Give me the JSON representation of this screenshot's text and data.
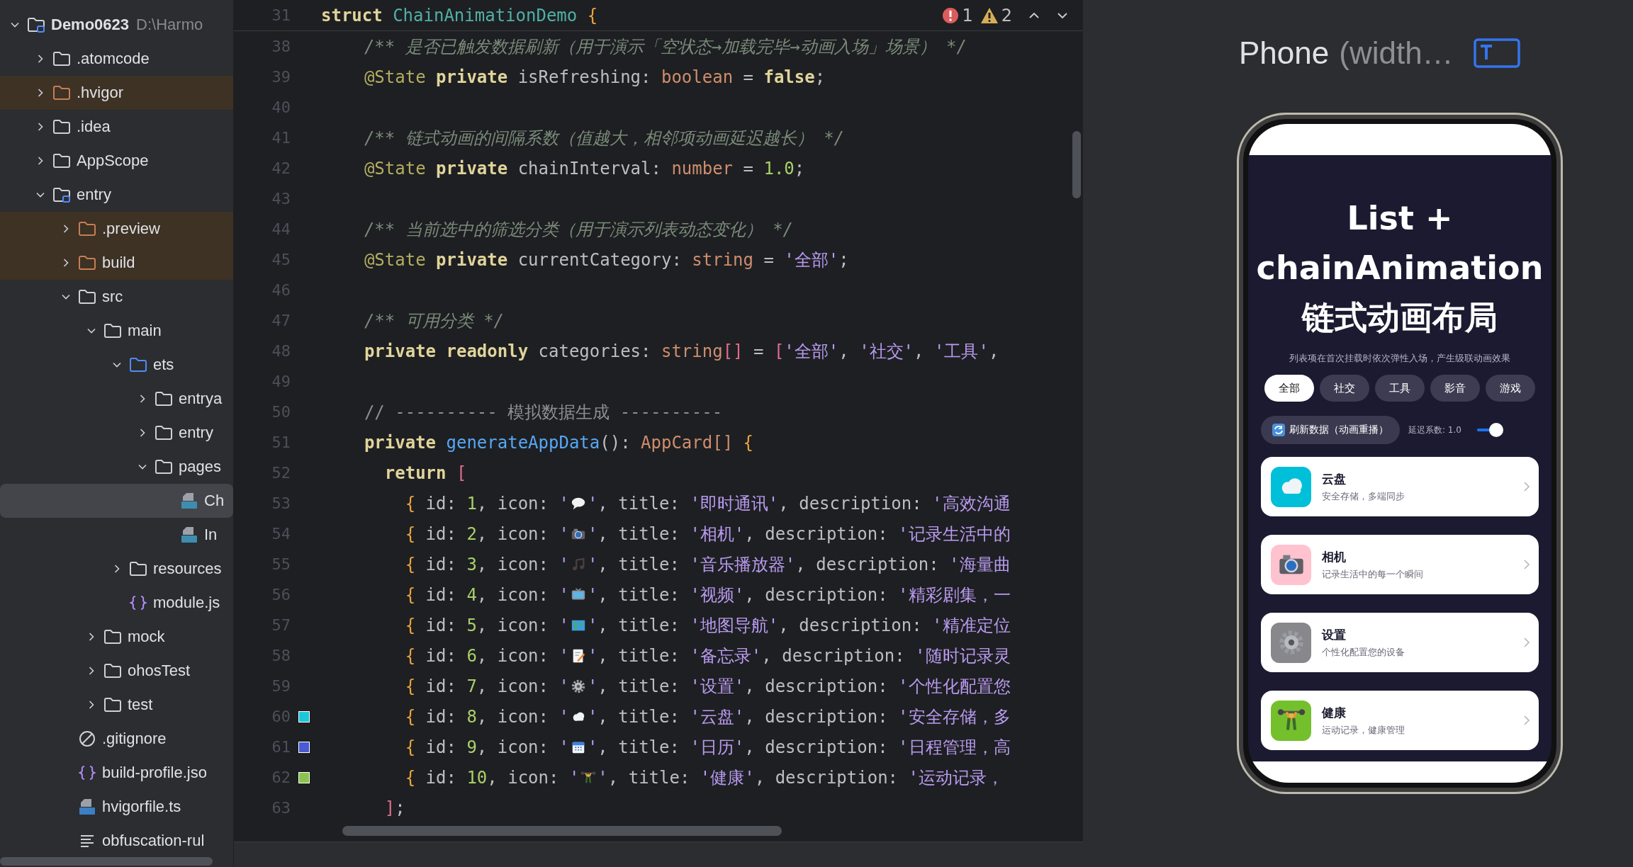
{
  "project_tree": {
    "name": "Demo0623",
    "path": "D:\\Harmo",
    "expanded": true,
    "children": [
      {
        "label": ".atomcode",
        "kind": "folder",
        "expanded": false,
        "excluded": false
      },
      {
        "label": ".hvigor",
        "kind": "folder",
        "expanded": false,
        "excluded": true
      },
      {
        "label": ".idea",
        "kind": "folder",
        "expanded": false,
        "excluded": false
      },
      {
        "label": "AppScope",
        "kind": "folder",
        "expanded": false,
        "excluded": false
      },
      {
        "label": "entry",
        "kind": "module",
        "expanded": true,
        "excluded": false,
        "children": [
          {
            "label": ".preview",
            "kind": "folder",
            "expanded": false,
            "excluded": true
          },
          {
            "label": "build",
            "kind": "folder",
            "expanded": false,
            "excluded": true
          },
          {
            "label": "src",
            "kind": "folder",
            "expanded": true,
            "excluded": false,
            "children": [
              {
                "label": "main",
                "kind": "folder",
                "expanded": true,
                "excluded": false,
                "children": [
                  {
                    "label": "ets",
                    "kind": "source",
                    "expanded": true,
                    "excluded": false,
                    "children": [
                      {
                        "label": "entrya",
                        "kind": "folder",
                        "expanded": false,
                        "excluded": false
                      },
                      {
                        "label": "entry",
                        "kind": "folder",
                        "expanded": false,
                        "excluded": false
                      },
                      {
                        "label": "pages",
                        "kind": "folder",
                        "expanded": true,
                        "excluded": false,
                        "children": [
                          {
                            "label": "Ch",
                            "kind": "ets",
                            "selected": true
                          },
                          {
                            "label": "In",
                            "kind": "ets",
                            "selected": false
                          }
                        ]
                      }
                    ]
                  },
                  {
                    "label": "resources",
                    "kind": "folder",
                    "expanded": false,
                    "excluded": false
                  },
                  {
                    "label": "module.js",
                    "kind": "json",
                    "selected": false
                  }
                ]
              },
              {
                "label": "mock",
                "kind": "folder",
                "expanded": false,
                "excluded": false
              },
              {
                "label": "ohosTest",
                "kind": "folder",
                "expanded": false,
                "excluded": false
              },
              {
                "label": "test",
                "kind": "folder",
                "expanded": false,
                "excluded": false
              }
            ]
          },
          {
            "label": ".gitignore",
            "kind": "ignore",
            "selected": false
          },
          {
            "label": "build-profile.jso",
            "kind": "json",
            "selected": false
          },
          {
            "label": "hvigorfile.ts",
            "kind": "ts",
            "selected": false
          },
          {
            "label": "obfuscation-rul",
            "kind": "text",
            "selected": false
          }
        ]
      }
    ]
  },
  "editor": {
    "sticky_line": {
      "number": "31",
      "segments": [
        {
          "kind": "kw",
          "text": "struct"
        },
        {
          "kind": "cls",
          "text": " ChainAnimationDemo"
        },
        {
          "kind": "brace",
          "text": " {"
        }
      ]
    },
    "inspections": {
      "errors": "1",
      "warnings": "2"
    },
    "lines": [
      {
        "number": "38",
        "segments": [
          {
            "kind": "cmt",
            "text": "  /** 是否已触发数据刷新（用于演示「空状态→加载完毕→动画入场」场景） */"
          }
        ]
      },
      {
        "number": "39",
        "segments": [
          {
            "kind": "ann",
            "text": "  @State"
          },
          {
            "kind": "kw",
            "text": " private"
          },
          {
            "kind": "plain",
            "text": " isRefreshing: "
          },
          {
            "kind": "type",
            "text": "boolean"
          },
          {
            "kind": "plain",
            "text": " = "
          },
          {
            "kind": "kw",
            "text": "false"
          },
          {
            "kind": "plain",
            "text": ";"
          }
        ]
      },
      {
        "number": "40"
      },
      {
        "number": "41",
        "segments": [
          {
            "kind": "cmt",
            "text": "  /** 链式动画的间隔系数（值越大，相邻项动画延迟越长） */"
          }
        ]
      },
      {
        "number": "42",
        "segments": [
          {
            "kind": "ann",
            "text": "  @State"
          },
          {
            "kind": "kw",
            "text": " private"
          },
          {
            "kind": "plain",
            "text": " chainInterval: "
          },
          {
            "kind": "type",
            "text": "number"
          },
          {
            "kind": "plain",
            "text": " = "
          },
          {
            "kind": "num",
            "text": "1.0"
          },
          {
            "kind": "plain",
            "text": ";"
          }
        ]
      },
      {
        "number": "43"
      },
      {
        "number": "44",
        "segments": [
          {
            "kind": "cmt",
            "text": "  /** 当前选中的筛选分类（用于演示列表动态变化） */"
          }
        ]
      },
      {
        "number": "45",
        "segments": [
          {
            "kind": "ann",
            "text": "  @State"
          },
          {
            "kind": "kw",
            "text": " private"
          },
          {
            "kind": "plain",
            "text": " currentCategory: "
          },
          {
            "kind": "type",
            "text": "string"
          },
          {
            "kind": "plain",
            "text": " = "
          },
          {
            "kind": "str",
            "text": "'全部'"
          },
          {
            "kind": "plain",
            "text": ";"
          }
        ]
      },
      {
        "number": "46"
      },
      {
        "number": "47",
        "segments": [
          {
            "kind": "cmt",
            "text": "  /** 可用分类 */"
          }
        ]
      },
      {
        "number": "48",
        "segments": [
          {
            "kind": "kw",
            "text": "  private readonly"
          },
          {
            "kind": "plain",
            "text": " categories: "
          },
          {
            "kind": "type",
            "text": "string"
          },
          {
            "kind": "bracket",
            "text": "[]"
          },
          {
            "kind": "plain",
            "text": " = "
          },
          {
            "kind": "bracket",
            "text": "["
          },
          {
            "kind": "str",
            "text": "'全部'"
          },
          {
            "kind": "plain",
            "text": ", "
          },
          {
            "kind": "str",
            "text": "'社交'"
          },
          {
            "kind": "plain",
            "text": ", "
          },
          {
            "kind": "str",
            "text": "'工具'"
          },
          {
            "kind": "plain",
            "text": ","
          }
        ]
      },
      {
        "number": "49"
      },
      {
        "number": "50",
        "segments": [
          {
            "kind": "linecmt",
            "text": "  // ---------- 模拟数据生成 ----------"
          }
        ]
      },
      {
        "number": "51",
        "segments": [
          {
            "kind": "kw",
            "text": "  private"
          },
          {
            "kind": "fn",
            "text": " generateAppData"
          },
          {
            "kind": "plain",
            "text": "(): "
          },
          {
            "kind": "type",
            "text": "AppCard[]"
          },
          {
            "kind": "brace",
            "text": " {"
          }
        ]
      },
      {
        "number": "52",
        "segments": [
          {
            "kind": "kw",
            "text": "    return"
          },
          {
            "kind": "bracket",
            "text": " ["
          }
        ]
      },
      {
        "number": "53",
        "segments": [
          {
            "kind": "brace",
            "text": "      {"
          },
          {
            "kind": "plain",
            "text": " id: "
          },
          {
            "kind": "num",
            "text": "1"
          },
          {
            "kind": "plain",
            "text": ", icon: "
          },
          {
            "kind": "str",
            "text": "'"
          },
          {
            "kind": "icon"
          },
          {
            "kind": "str",
            "text": "'"
          },
          {
            "kind": "plain",
            "text": ", title: "
          },
          {
            "kind": "str",
            "text": "'即时通讯'"
          },
          {
            "kind": "plain",
            "text": ", description: "
          },
          {
            "kind": "str",
            "text": "'高效沟通"
          }
        ]
      },
      {
        "number": "54",
        "segments": [
          {
            "kind": "brace",
            "text": "      {"
          },
          {
            "kind": "plain",
            "text": " id: "
          },
          {
            "kind": "num",
            "text": "2"
          },
          {
            "kind": "plain",
            "text": ", icon: "
          },
          {
            "kind": "str",
            "text": "'"
          },
          {
            "kind": "icon"
          },
          {
            "kind": "str",
            "text": "'"
          },
          {
            "kind": "plain",
            "text": ", title: "
          },
          {
            "kind": "str",
            "text": "'相机'"
          },
          {
            "kind": "plain",
            "text": ", description: "
          },
          {
            "kind": "str",
            "text": "'记录生活中的"
          }
        ]
      },
      {
        "number": "55",
        "segments": [
          {
            "kind": "brace",
            "text": "      {"
          },
          {
            "kind": "plain",
            "text": " id: "
          },
          {
            "kind": "num",
            "text": "3"
          },
          {
            "kind": "plain",
            "text": ", icon: "
          },
          {
            "kind": "str",
            "text": "'"
          },
          {
            "kind": "icon"
          },
          {
            "kind": "str",
            "text": "'"
          },
          {
            "kind": "plain",
            "text": ", title: "
          },
          {
            "kind": "str",
            "text": "'音乐播放器'"
          },
          {
            "kind": "plain",
            "text": ", description: "
          },
          {
            "kind": "str",
            "text": "'海量曲"
          }
        ]
      },
      {
        "number": "56",
        "segments": [
          {
            "kind": "brace",
            "text": "      {"
          },
          {
            "kind": "plain",
            "text": " id: "
          },
          {
            "kind": "num",
            "text": "4"
          },
          {
            "kind": "plain",
            "text": ", icon: "
          },
          {
            "kind": "str",
            "text": "'"
          },
          {
            "kind": "icon"
          },
          {
            "kind": "str",
            "text": "'"
          },
          {
            "kind": "plain",
            "text": ", title: "
          },
          {
            "kind": "str",
            "text": "'视频'"
          },
          {
            "kind": "plain",
            "text": ", description: "
          },
          {
            "kind": "str",
            "text": "'精彩剧集，一"
          }
        ]
      },
      {
        "number": "57",
        "segments": [
          {
            "kind": "brace",
            "text": "      {"
          },
          {
            "kind": "plain",
            "text": " id: "
          },
          {
            "kind": "num",
            "text": "5"
          },
          {
            "kind": "plain",
            "text": ", icon: "
          },
          {
            "kind": "str",
            "text": "'"
          },
          {
            "kind": "icon"
          },
          {
            "kind": "str",
            "text": "'"
          },
          {
            "kind": "plain",
            "text": ", title: "
          },
          {
            "kind": "str",
            "text": "'地图导航'"
          },
          {
            "kind": "plain",
            "text": ", description: "
          },
          {
            "kind": "str",
            "text": "'精准定位"
          }
        ]
      },
      {
        "number": "58",
        "segments": [
          {
            "kind": "brace",
            "text": "      {"
          },
          {
            "kind": "plain",
            "text": " id: "
          },
          {
            "kind": "num",
            "text": "6"
          },
          {
            "kind": "plain",
            "text": ", icon: "
          },
          {
            "kind": "str",
            "text": "'"
          },
          {
            "kind": "icon"
          },
          {
            "kind": "str",
            "text": "'"
          },
          {
            "kind": "plain",
            "text": ", title: "
          },
          {
            "kind": "str",
            "text": "'备忘录'"
          },
          {
            "kind": "plain",
            "text": ", description: "
          },
          {
            "kind": "str",
            "text": "'随时记录灵"
          }
        ]
      },
      {
        "number": "59",
        "segments": [
          {
            "kind": "brace",
            "text": "      {"
          },
          {
            "kind": "plain",
            "text": " id: "
          },
          {
            "kind": "num",
            "text": "7"
          },
          {
            "kind": "plain",
            "text": ", icon: "
          },
          {
            "kind": "str",
            "text": "'"
          },
          {
            "kind": "icon"
          },
          {
            "kind": "str",
            "text": "'"
          },
          {
            "kind": "plain",
            "text": ", title: "
          },
          {
            "kind": "str",
            "text": "'设置'"
          },
          {
            "kind": "plain",
            "text": ", description: "
          },
          {
            "kind": "str",
            "text": "'个性化配置您"
          }
        ]
      },
      {
        "number": "60",
        "color": "#1ec6dc",
        "segments": [
          {
            "kind": "brace",
            "text": "      {"
          },
          {
            "kind": "plain",
            "text": " id: "
          },
          {
            "kind": "num",
            "text": "8"
          },
          {
            "kind": "plain",
            "text": ", icon: "
          },
          {
            "kind": "str",
            "text": "'"
          },
          {
            "kind": "icon"
          },
          {
            "kind": "str",
            "text": "'"
          },
          {
            "kind": "plain",
            "text": ", title: "
          },
          {
            "kind": "str",
            "text": "'云盘'"
          },
          {
            "kind": "plain",
            "text": ", description: "
          },
          {
            "kind": "str",
            "text": "'安全存储，多"
          }
        ]
      },
      {
        "number": "61",
        "color": "#4a5ad4",
        "segments": [
          {
            "kind": "brace",
            "text": "      {"
          },
          {
            "kind": "plain",
            "text": " id: "
          },
          {
            "kind": "num",
            "text": "9"
          },
          {
            "kind": "plain",
            "text": ", icon: "
          },
          {
            "kind": "str",
            "text": "'"
          },
          {
            "kind": "icon"
          },
          {
            "kind": "str",
            "text": "'"
          },
          {
            "kind": "plain",
            "text": ", title: "
          },
          {
            "kind": "str",
            "text": "'日历'"
          },
          {
            "kind": "plain",
            "text": ", description: "
          },
          {
            "kind": "str",
            "text": "'日程管理，高"
          }
        ]
      },
      {
        "number": "62",
        "color": "#8bc34a",
        "segments": [
          {
            "kind": "brace",
            "text": "      {"
          },
          {
            "kind": "plain",
            "text": " id: "
          },
          {
            "kind": "num",
            "text": "10"
          },
          {
            "kind": "plain",
            "text": ", icon: "
          },
          {
            "kind": "str",
            "text": "'"
          },
          {
            "kind": "icon"
          },
          {
            "kind": "str",
            "text": "'"
          },
          {
            "kind": "plain",
            "text": ", title: "
          },
          {
            "kind": "str",
            "text": "'健康'"
          },
          {
            "kind": "plain",
            "text": ", description: "
          },
          {
            "kind": "str",
            "text": "'运动记录，"
          }
        ]
      },
      {
        "number": "63",
        "segments": [
          {
            "kind": "bracket",
            "text": "    ]"
          },
          {
            "kind": "plain",
            "text": ";"
          }
        ]
      }
    ]
  },
  "preview": {
    "title": "Phone",
    "title_suffix": "(width…",
    "app": {
      "title": "List + chainAnimation 链式动画布局",
      "subtitle": "列表项在首次挂载时依次弹性入场，产生级联动画效果",
      "categories": [
        {
          "label": "全部",
          "selected": true
        },
        {
          "label": "社交",
          "selected": false
        },
        {
          "label": "工具",
          "selected": false
        },
        {
          "label": "影音",
          "selected": false
        },
        {
          "label": "游戏",
          "selected": false
        }
      ],
      "refresh_button": "刷新数据（动画重播）",
      "delay_label": "延迟系数: 1.0",
      "delay_slider": {
        "level": 0.75
      },
      "cards": [
        {
          "title": "云盘",
          "description": "安全存储，多端同步",
          "color": "#00c0d9"
        },
        {
          "title": "相机",
          "description": "记录生活中的每一个瞬间",
          "color": "#ffc2cf"
        },
        {
          "title": "设置",
          "description": "个性化配置您的设备",
          "color": "#88888c"
        },
        {
          "title": "健康",
          "description": "运动记录，健康管理",
          "color": "#74c02c"
        }
      ]
    }
  }
}
